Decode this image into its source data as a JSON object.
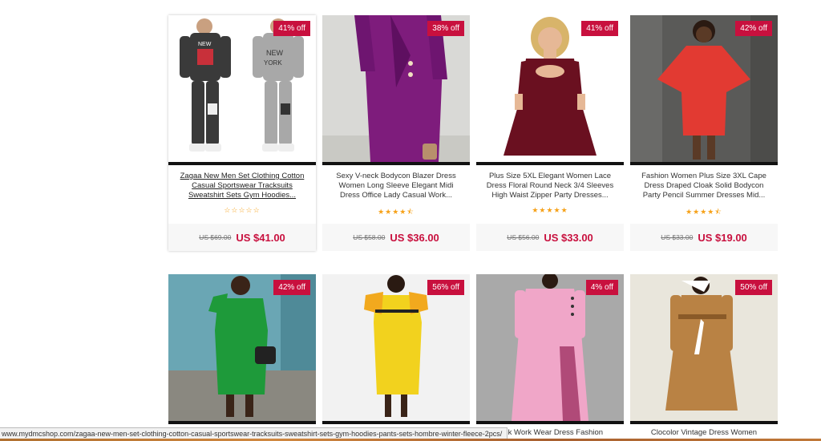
{
  "products_row1": [
    {
      "discount": "41% off",
      "title": "Zagaa New Men Set Clothing Cotton Casual Sportswear Tracksuits Sweatshirt Sets Gym Hoodies...",
      "stars": "☆☆☆☆☆",
      "old_price": "US $69.00",
      "new_price": "US $41.00",
      "image_icon": "tracksuit-image"
    },
    {
      "discount": "38% off",
      "title": "Sexy V-neck Bodycon Blazer Dress Women Long Sleeve Elegant Midi Dress Office Lady Casual Work...",
      "stars": "★★★★⯪",
      "old_price": "US $58.00",
      "new_price": "US $36.00",
      "image_icon": "purple-dress-image"
    },
    {
      "discount": "41% off",
      "title": "Plus Size 5XL Elegant Women Lace Dress Floral Round Neck 3/4 Sleeves High Waist Zipper Party Dresses...",
      "stars": "★★★★★",
      "old_price": "US $56.00",
      "new_price": "US $33.00",
      "image_icon": "lace-dress-image"
    },
    {
      "discount": "42% off",
      "title": "Fashion Women Plus Size 3XL Cape Dress Draped Cloak Solid Bodycon Party Pencil Summer Dresses Mid...",
      "stars": "★★★★⯪",
      "old_price": "US $33.00",
      "new_price": "US $19.00",
      "image_icon": "red-cape-dress-image"
    }
  ],
  "products_row2": [
    {
      "discount": "42% off",
      "title": "",
      "image_icon": "green-dress-image"
    },
    {
      "discount": "56% off",
      "title": "",
      "image_icon": "yellow-dress-image"
    },
    {
      "discount": "4% off",
      "title": "Pink Work Wear Dress Fashion",
      "image_icon": "pink-dress-image"
    },
    {
      "discount": "50% off",
      "title": "Clocolor Vintage Dress Women",
      "image_icon": "brown-dress-image"
    }
  ],
  "status_bar_url": "www.mydmcshop.com/zagaa-new-men-set-clothing-cotton-casual-sportswear-tracksuits-sweatshirt-sets-gym-hoodies-pants-sets-hombre-winter-fleece-2pcs/",
  "colors": {
    "accent": "#c8103e",
    "star": "#f6a21a",
    "price_bg": "#f7f7f7"
  }
}
